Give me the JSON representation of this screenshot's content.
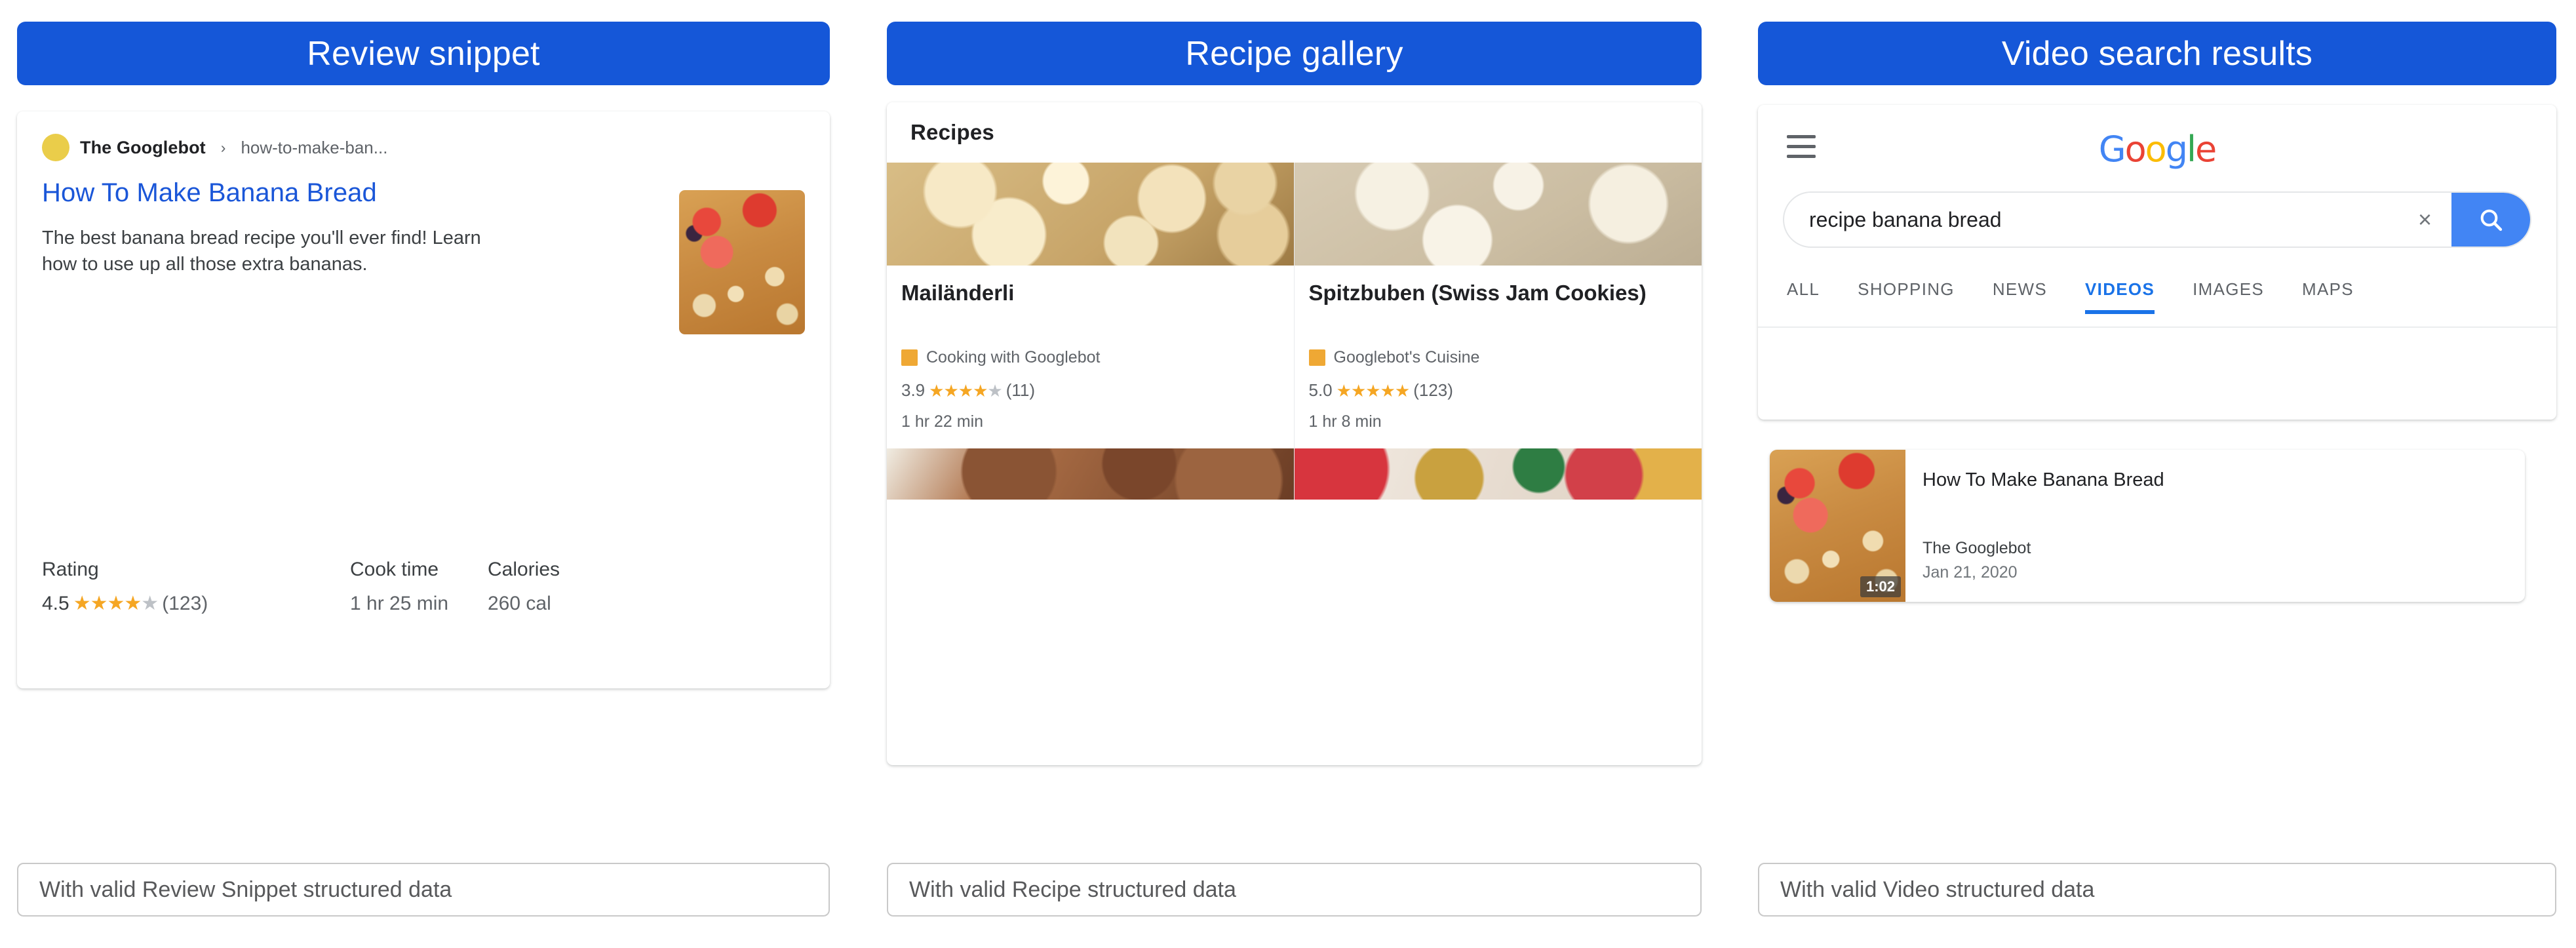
{
  "columns": [
    {
      "header": "Review snippet",
      "caption": "With valid Review Snippet structured data"
    },
    {
      "header": "Recipe gallery",
      "caption": "With valid Recipe structured data"
    },
    {
      "header": "Video search results",
      "caption": "With valid Video structured data"
    }
  ],
  "review_snippet": {
    "site_name": "The Googlebot",
    "breadcrumb_separator": "›",
    "url_path": "how-to-make-ban...",
    "title": "How To Make Banana Bread",
    "description": "The best banana bread recipe you'll ever find! Learn how to use up all those extra bananas.",
    "meta": [
      {
        "label": "Rating",
        "value": "4.5",
        "stars_full": 4,
        "stars_half": 1,
        "stars_empty": 0,
        "count": "(123)"
      },
      {
        "label": "Cook time",
        "value": "1 hr 25 min"
      },
      {
        "label": "Calories",
        "value": "260 cal"
      }
    ],
    "thumbnail_alt": "banana-bread-thumbnail"
  },
  "recipe_gallery": {
    "section_title": "Recipes",
    "items": [
      {
        "name": "Mailänderli",
        "source": "Cooking with Googlebot",
        "rating": "3.9",
        "stars_full": 4,
        "stars_empty": 1,
        "count": "(11)",
        "time": "1 hr 22 min",
        "image_alt": "butter-cookies-photo",
        "image_alt_2": "chocolate-cookies-photo"
      },
      {
        "name": "Spitzbuben (Swiss Jam Cookies)",
        "source": "Googlebot's Cuisine",
        "rating": "5.0",
        "stars_full": 5,
        "stars_empty": 0,
        "count": "(123)",
        "time": "1 hr 8 min",
        "image_alt": "jam-cookies-photo",
        "image_alt_2": "christmas-cookies-photo"
      }
    ]
  },
  "video_search": {
    "logo": {
      "g1": "G",
      "o1": "o",
      "o2": "o",
      "g2": "g",
      "l": "l",
      "e": "e"
    },
    "search_query": "recipe banana bread",
    "search_placeholder": "Search",
    "clear_label": "×",
    "tabs": [
      {
        "label": "ALL",
        "active": false
      },
      {
        "label": "SHOPPING",
        "active": false
      },
      {
        "label": "NEWS",
        "active": false
      },
      {
        "label": "VIDEOS",
        "active": true
      },
      {
        "label": "IMAGES",
        "active": false
      },
      {
        "label": "MAPS",
        "active": false
      }
    ],
    "result": {
      "title": "How To Make Banana Bread",
      "source": "The Googlebot",
      "date": "Jan 21, 2020",
      "duration": "1:02",
      "thumbnail_alt": "banana-bread-video-thumbnail"
    }
  },
  "colors": {
    "header_blue": "#1557d8",
    "link_blue": "#1a56d8",
    "tab_active_blue": "#1a73e8",
    "star_gold": "#f5a623",
    "star_grey": "#bdc1c6",
    "favicon_orange": "#efa834",
    "avatar_yellow": "#eacd4a",
    "search_button_blue": "#4285f4"
  }
}
